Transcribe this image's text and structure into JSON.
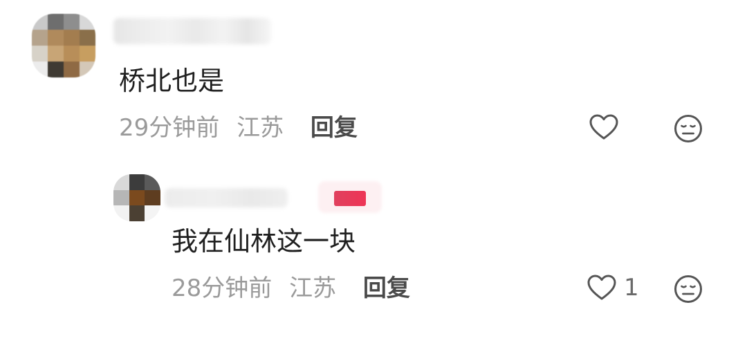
{
  "comments": [
    {
      "text": "桥北也是",
      "time": "29分钟前",
      "location": "江苏",
      "reply_label": "回复",
      "like_count": "",
      "avatar_colors": [
        "#c9c9c9",
        "#6e6e6e",
        "#8e8e8e",
        "#d8d8d8",
        "#b5a38c",
        "#b08a5c",
        "#a37d4f",
        "#8a6f4a",
        "#d7d2c8",
        "#c8a576",
        "#b88e59",
        "#c79e60",
        "#ececec",
        "#3f3a33",
        "#8f6a44",
        "#d4c8b8"
      ]
    },
    {
      "text": "我在仙林这一块",
      "time": "28分钟前",
      "location": "江苏",
      "reply_label": "回复",
      "like_count": "1",
      "avatar_colors": [
        "#d9d9d9",
        "#3c3c3c",
        "#5a5a5a",
        "#b6b6b6",
        "#7b4a1e",
        "#5e3d20",
        "#f2f2f2",
        "#4b4033",
        "#f4f4f4"
      ]
    }
  ],
  "icons": {
    "like": "heart-outline-icon",
    "dislike": "meh-face-icon"
  },
  "colors": {
    "text_primary": "#1f1f1f",
    "text_meta": "#9a9a9a",
    "reply": "#4a4a4a",
    "icon_stroke": "#555555",
    "badge": "#e83a5a"
  }
}
